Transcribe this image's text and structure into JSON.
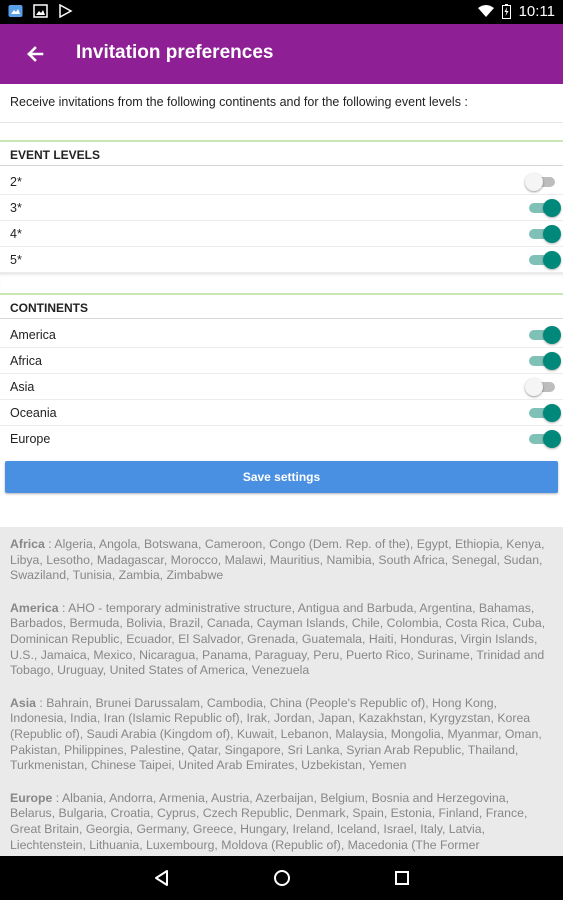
{
  "status_bar": {
    "time": "10:11",
    "left_icons": [
      "photos-icon",
      "image-icon",
      "play-store-icon"
    ],
    "right_icons": [
      "wifi-icon",
      "battery-charging-icon"
    ]
  },
  "app_bar": {
    "title": "Invitation preferences",
    "color": "#8e1f94"
  },
  "intro_text": "Receive invitations from the following continents and for the following event levels :",
  "event_levels": {
    "header": "EVENT LEVELS",
    "items": [
      {
        "label": "2*",
        "enabled": false
      },
      {
        "label": "3*",
        "enabled": true
      },
      {
        "label": "4*",
        "enabled": true
      },
      {
        "label": "5*",
        "enabled": true
      }
    ]
  },
  "continents": {
    "header": "CONTINENTS",
    "items": [
      {
        "label": "America",
        "enabled": true
      },
      {
        "label": "Africa",
        "enabled": true
      },
      {
        "label": "Asia",
        "enabled": false
      },
      {
        "label": "Oceania",
        "enabled": true
      },
      {
        "label": "Europe",
        "enabled": true
      }
    ]
  },
  "save_button": {
    "label": "Save settings",
    "color": "#4a90e2"
  },
  "toggle_on_color": "#00897b",
  "continent_info": [
    {
      "name": "Africa",
      "countries": " : Algeria, Angola, Botswana, Cameroon, Congo (Dem. Rep. of the), Egypt, Ethiopia, Kenya, Libya, Lesotho, Madagascar, Morocco, Malawi, Mauritius, Namibia, South Africa, Senegal, Sudan, Swaziland, Tunisia, Zambia, Zimbabwe"
    },
    {
      "name": "America",
      "countries": " : AHO - temporary administrative structure, Antigua and Barbuda, Argentina, Bahamas, Barbados, Bermuda, Bolivia, Brazil, Canada, Cayman Islands, Chile, Colombia, Costa Rica, Cuba, Dominican Republic, Ecuador, El Salvador, Grenada, Guatemala, Haiti, Honduras, Virgin Islands, U.S., Jamaica, Mexico, Nicaragua, Panama, Paraguay, Peru, Puerto Rico, Suriname, Trinidad and Tobago, Uruguay, United States of America, Venezuela"
    },
    {
      "name": "Asia",
      "countries": " : Bahrain, Brunei Darussalam, Cambodia, China (People's Republic of), Hong Kong, Indonesia, India, Iran (Islamic Republic of), Irak, Jordan, Japan, Kazakhstan, Kyrgyzstan, Korea (Republic of), Saudi Arabia (Kingdom of), Kuwait, Lebanon, Malaysia, Mongolia, Myanmar, Oman, Pakistan, Philippines, Palestine, Qatar, Singapore, Sri Lanka, Syrian Arab Republic, Thailand, Turkmenistan, Chinese Taipei, United Arab Emirates, Uzbekistan, Yemen"
    },
    {
      "name": "Europe",
      "countries": " : Albania, Andorra, Armenia, Austria, Azerbaijan, Belgium, Bosnia and Herzegovina, Belarus, Bulgaria, Croatia, Cyprus, Czech Republic, Denmark, Spain, Estonia, Finland, France, Great Britain, Georgia, Germany, Greece, Hungary, Ireland, Iceland, Israel, Italy, Latvia, Liechtenstein, Lithuania, Luxembourg, Moldova (Republic of), Macedonia (The Former"
    }
  ],
  "nav_bar": {
    "buttons": [
      "back-triangle-icon",
      "home-circle-icon",
      "recents-square-icon"
    ]
  }
}
